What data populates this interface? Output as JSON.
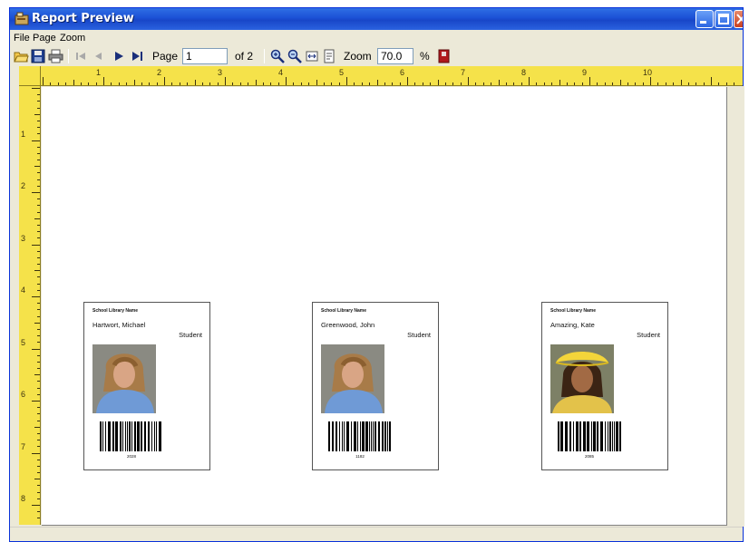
{
  "window": {
    "title": "Report Preview",
    "colors": {
      "titlebar": "#1b50d6",
      "ruler": "#f5e24a",
      "chrome": "#ece9d8"
    }
  },
  "menu": {
    "items": [
      "File",
      "Page",
      "Zoom"
    ]
  },
  "toolbar": {
    "icons": [
      "open-folder-icon",
      "save-disk-icon",
      "print-icon",
      "first-page-icon",
      "previous-page-icon",
      "next-page-icon",
      "last-page-icon",
      "zoom-in-icon",
      "zoom-out-icon",
      "fit-width-icon",
      "fit-page-icon",
      "exit-icon"
    ],
    "page_label": "Page",
    "page_value": "1",
    "page_of": "of 2",
    "zoom_label": "Zoom",
    "zoom_value": "70.0",
    "zoom_unit": "%"
  },
  "rulers": {
    "top_numbers": [
      "1",
      "2",
      "3",
      "4",
      "5",
      "6",
      "7",
      "8",
      "9",
      "10"
    ],
    "left_numbers": [
      "1",
      "2",
      "3",
      "4",
      "5",
      "6",
      "7",
      "8"
    ]
  },
  "cards": [
    {
      "school": "School Library Name",
      "name": "Hartwort, Michael",
      "role": "Student",
      "code": "2028",
      "photo": "young-man-long-hair"
    },
    {
      "school": "School Library Name",
      "name": "Greenwood, John",
      "role": "Student",
      "code": "1182",
      "photo": "young-man-long-hair"
    },
    {
      "school": "School Library Name",
      "name": "Amazing, Kate",
      "role": "Student",
      "code": "2085",
      "photo": "young-woman-yellow-hat"
    }
  ]
}
